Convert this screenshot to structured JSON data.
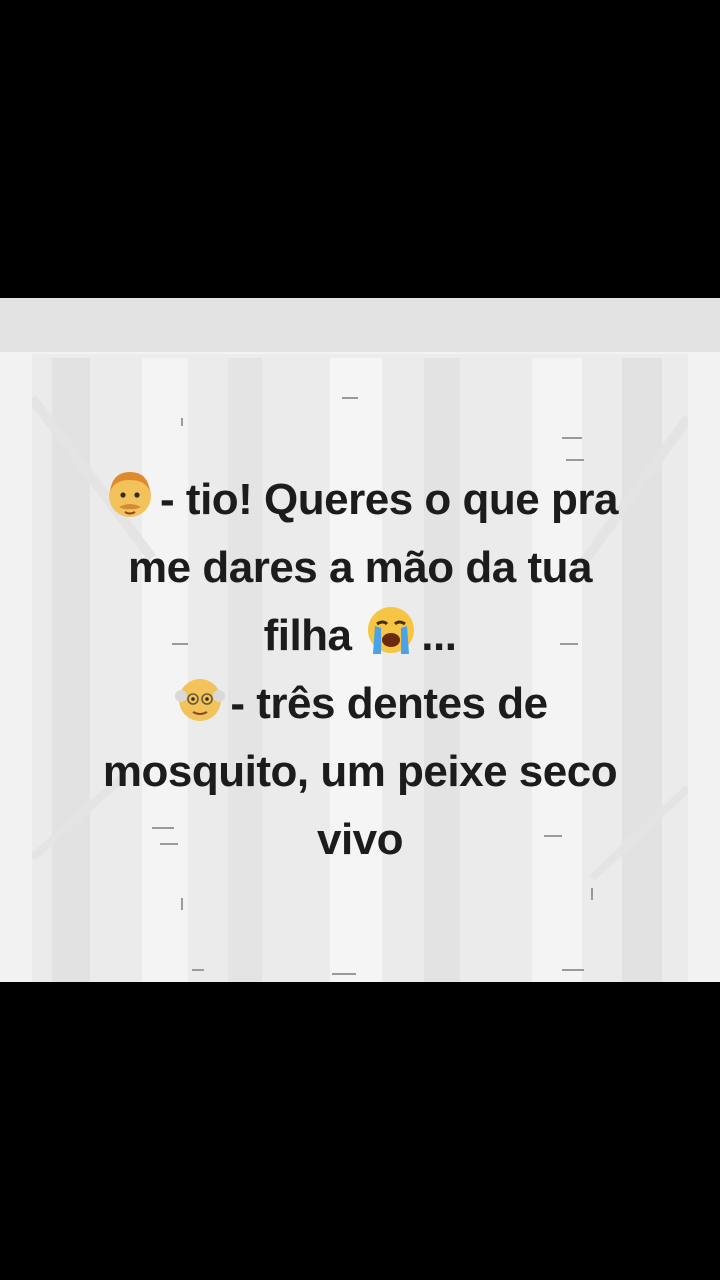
{
  "post": {
    "lines": [
      {
        "emoji": "man-face-icon",
        "text": "- tio! Queres o que pra"
      },
      {
        "text": "me dares a mão da tua"
      },
      {
        "text_before": "filha",
        "emoji": "crying-face-icon",
        "text_after": "..."
      },
      {
        "emoji": "old-man-face-icon",
        "text": "- três dentes de"
      },
      {
        "text": "mosquito, um peixe seco"
      },
      {
        "text": "vivo"
      }
    ]
  },
  "colors": {
    "text": "#1c1c1c",
    "background": "#ededed",
    "letterbox": "#000000"
  }
}
